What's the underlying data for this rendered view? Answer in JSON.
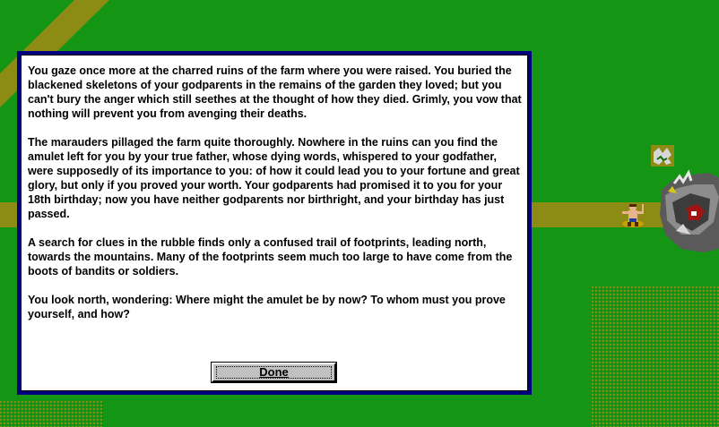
{
  "story": {
    "paragraphs": [
      "You gaze once more at the charred ruins of the farm where you were raised.  You buried the blackened skeletons of your godparents in the remains of the garden they loved; but you can't bury the anger which still seethes at the thought of how they died.  Grimly, you vow that nothing will prevent you from avenging their deaths.",
      "The marauders pillaged the farm quite thoroughly.  Nowhere in the ruins can you find the amulet left for you by your true father, whose dying words, whispered to your godfather, were supposedly of its importance to you: of how it could lead you to your fortune and great glory, but only if you proved your worth.  Your godparents had promised it to you for your 18th birthday; now you have neither godparents nor birthright, and your birthday has just passed.",
      "A search for clues in the rubble finds only a confused trail of footprints, leading north, towards the mountains.  Many of the footprints seem much too large to have come from the boots of bandits or soldiers.",
      "You look north, wondering:  Where might the amulet be by now?  To whom must you prove yourself, and how?"
    ]
  },
  "dialog": {
    "done_label": "Done"
  },
  "colors": {
    "grass": "#149614",
    "road": "#8c8c14",
    "dialog_border": "#000080"
  }
}
